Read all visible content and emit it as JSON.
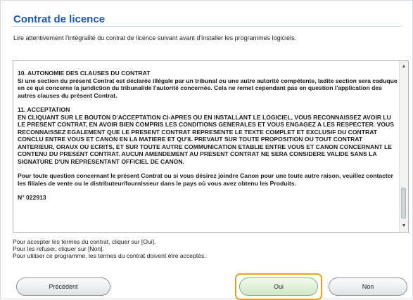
{
  "header": {
    "title": "Contrat de licence",
    "intro": "Lire attentivement l'intégralité du contrat de licence suivant avant d'installer les programmes logiciels."
  },
  "license": {
    "sections": [
      {
        "heading": "10. AUTONOMIE DES CLAUSES DU CONTRAT",
        "body": "Si une section du présent Contrat est déclarée illégale par un tribunal ou une autre autorité compétente, ladite section sera caduque en ce qui concerne la juridiction du tribunal/de l'autorité concernée. Cela ne remet cependant pas en question l'application des autres clauses du présent Contrat."
      },
      {
        "heading": "11. ACCEPTATION",
        "body": "EN CLIQUANT SUR LE BOUTON D'ACCEPTATION CI-APRES OU EN INSTALLANT LE LOGICIEL, VOUS RECONNAISSEZ AVOIR LU LE PRESENT CONTRAT, EN AVOIR BIEN COMPRIS LES CONDITIONS GENERALES ET VOUS ENGAGEZ A LES RESPECTER. VOUS RECONNAISSEZ EGALEMENT QUE LE PRESENT CONTRAT REPRESENTE LE TEXTE COMPLET ET EXCLUSIF DU CONTRAT CONCLU ENTRE VOUS ET CANON EN LA MATIERE ET QU'IL PREVAUT SUR TOUTE PROPOSITION OU TOUT CONTRAT ANTERIEUR, ORAUX OU ECRITS, ET SUR TOUTE AUTRE COMMUNICATION ETABLIE ENTRE VOUS ET CANON CONCERNANT LE CONTENU DU PRESENT CONTRAT. AUCUN AMENDEMENT AU PRESENT CONTRAT NE SERA CONSIDERE VALIDE SANS LA SIGNATURE D'UN REPRESENTANT OFFICIEL DE CANON."
      }
    ],
    "contact": "Pour toute question concernant le présent Contrat ou si vous désirez joindre Canon pour une toute autre raison, veuillez contacter les filiales de vente ou le distributeur/fournisseur dans le pays où vous avez obtenu les Produits.",
    "number": "N° 022913"
  },
  "instructions": {
    "line1": "Pour accepter les termes du contrat, cliquer sur [Oui].",
    "line2": "Pour les refuser, cliquer sur [Non].",
    "line3": "Pour utiliser ce programme, les termes du contrat doivent être acceptés."
  },
  "buttons": {
    "previous": "Précédent",
    "yes": "Oui",
    "no": "Non"
  },
  "colors": {
    "title": "#1c56a8",
    "focus_ring": "#f0a020"
  }
}
